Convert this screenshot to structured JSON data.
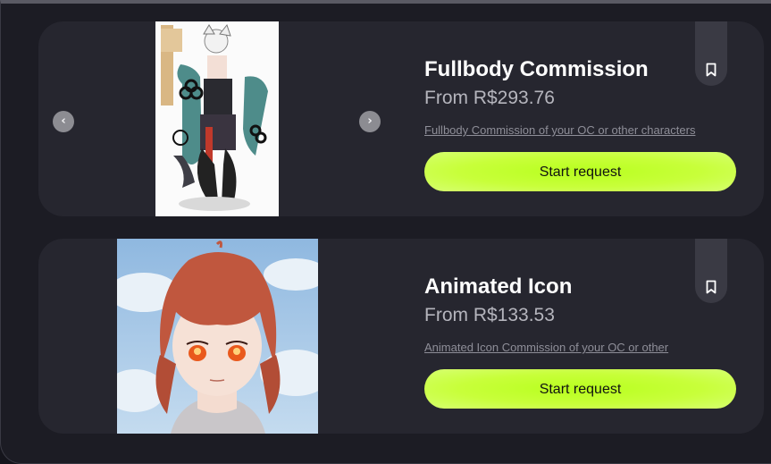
{
  "listings": [
    {
      "title": "Fullbody Commission",
      "price": "From R$293.76",
      "description": "Fullbody Commission of your OC or other characters",
      "cta": "Start request",
      "prev_icon": "chevron-left-icon",
      "next_icon": "chevron-right-icon",
      "bookmark_icon": "bookmark-icon"
    },
    {
      "title": "Animated Icon",
      "price": "From R$133.53",
      "description": "Animated Icon Commission of your OC or other ",
      "cta": "Start request",
      "bookmark_icon": "bookmark-icon"
    }
  ],
  "colors": {
    "background": "#1c1c24",
    "card": "#26262f",
    "cta": "#c4ff2e",
    "title": "#ffffff",
    "price": "#b5b5bd",
    "description": "#8e8e98"
  }
}
